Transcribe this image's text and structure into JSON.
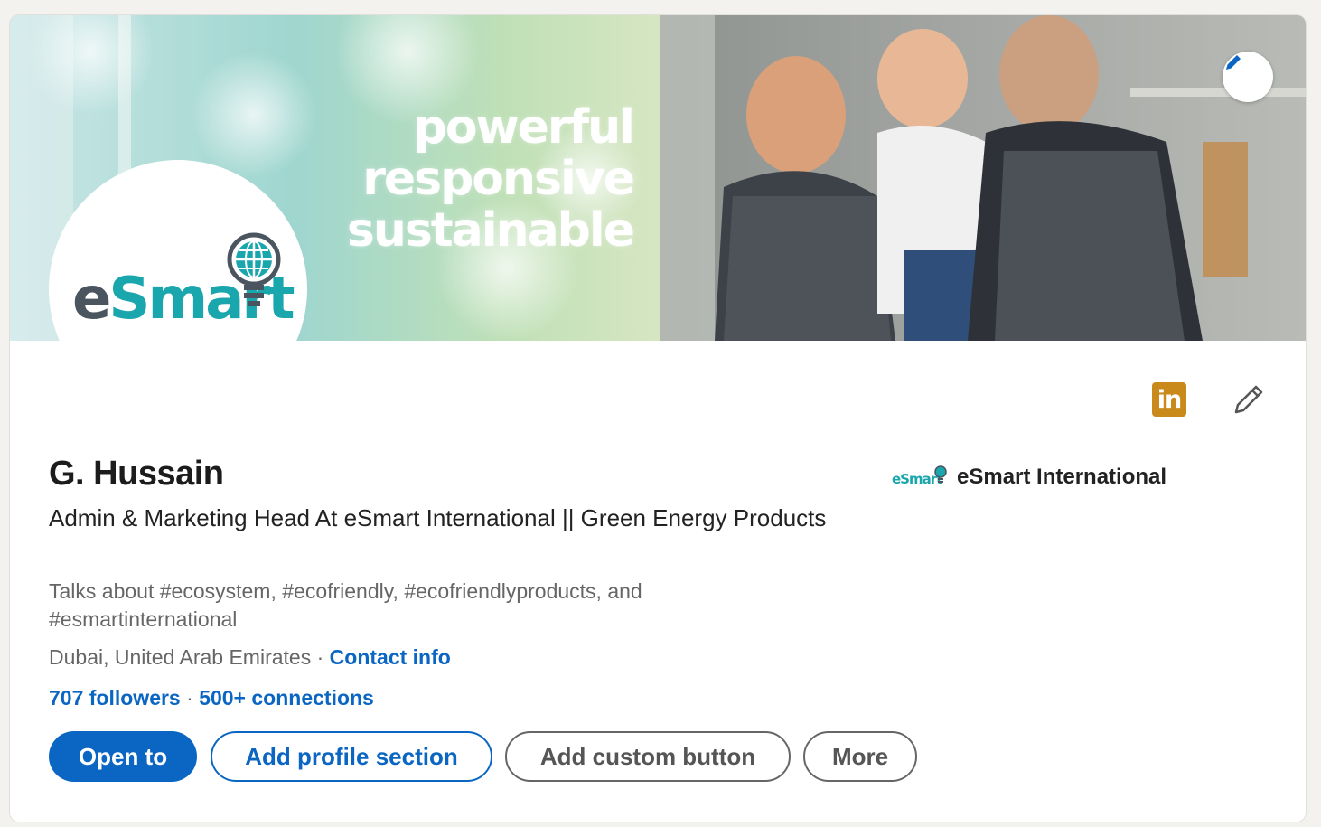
{
  "banner": {
    "tagline": [
      "powerful",
      "responsive",
      "sustainable"
    ]
  },
  "avatar": {
    "logo_e": "e",
    "logo_rest": "Smart"
  },
  "profile": {
    "name": "G. Hussain",
    "headline": "Admin & Marketing Head At eSmart International || Green Energy Products",
    "talks_about": "Talks about #ecosystem, #ecofriendly, #ecofriendlyproducts, and #esmartinternational",
    "location": "Dubai, United Arab Emirates",
    "location_sep": " · ",
    "contact_info": "Contact info",
    "followers": "707 followers",
    "stats_sep": " · ",
    "connections": "500+ connections"
  },
  "company": {
    "logo_text": "eSmart",
    "name": "eSmart International"
  },
  "linkedin_badge": "in",
  "buttons": {
    "open_to": "Open to",
    "add_profile_section": "Add profile section",
    "add_custom_button": "Add custom button",
    "more": "More"
  },
  "icons": {
    "banner_edit": "pencil-icon",
    "intro_edit": "pencil-icon",
    "linkedin": "linkedin-icon"
  },
  "colors": {
    "accent": "#0a66c2",
    "linkedin_badge": "#c98a1b",
    "brand_teal": "#1aa6ad"
  }
}
